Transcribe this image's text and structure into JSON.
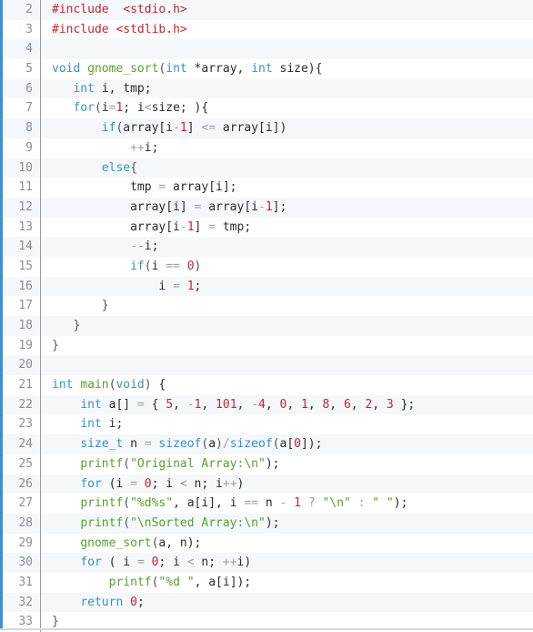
{
  "editor": {
    "language": "c",
    "accent_color": "#3b8fd6",
    "lines": [
      {
        "n": "2",
        "tokens": [
          [
            "pp",
            "#include"
          ],
          [
            "",
            "  "
          ],
          [
            "inc",
            "<stdio.h>"
          ]
        ]
      },
      {
        "n": "3",
        "tokens": [
          [
            "pp",
            "#include"
          ],
          [
            "inc",
            " <stdlib.h>"
          ]
        ]
      },
      {
        "n": "4",
        "tokens": []
      },
      {
        "n": "5",
        "tokens": [
          [
            "kw",
            "void"
          ],
          [
            "",
            " "
          ],
          [
            "fn",
            "gnome_sort"
          ],
          [
            "pun",
            "("
          ],
          [
            "kw",
            "int"
          ],
          [
            "",
            " *array, "
          ],
          [
            "kw",
            "int"
          ],
          [
            "",
            " size){"
          ]
        ]
      },
      {
        "n": "6",
        "tokens": [
          [
            "",
            "   "
          ],
          [
            "kw",
            "int"
          ],
          [
            "",
            " i, tmp;"
          ]
        ]
      },
      {
        "n": "7",
        "tokens": [
          [
            "",
            "   "
          ],
          [
            "kw",
            "for"
          ],
          [
            "pun",
            "("
          ],
          [
            "",
            "i"
          ],
          [
            "op",
            "="
          ],
          [
            "num",
            "1"
          ],
          [
            "",
            "; i"
          ],
          [
            "op",
            "<"
          ],
          [
            "",
            "size; ){"
          ]
        ]
      },
      {
        "n": "8",
        "tokens": [
          [
            "",
            "       "
          ],
          [
            "kw",
            "if"
          ],
          [
            "pun",
            "("
          ],
          [
            "",
            "array[i"
          ],
          [
            "op",
            "-"
          ],
          [
            "num",
            "1"
          ],
          [
            "",
            "] "
          ],
          [
            "op",
            "<="
          ],
          [
            "",
            " array[i])"
          ]
        ]
      },
      {
        "n": "9",
        "tokens": [
          [
            "",
            "           "
          ],
          [
            "op",
            "++"
          ],
          [
            "",
            "i;"
          ]
        ]
      },
      {
        "n": "10",
        "tokens": [
          [
            "",
            "       "
          ],
          [
            "kw",
            "else"
          ],
          [
            "pun",
            "{"
          ]
        ]
      },
      {
        "n": "11",
        "tokens": [
          [
            "",
            "           tmp "
          ],
          [
            "op",
            "="
          ],
          [
            "",
            " array[i];"
          ]
        ]
      },
      {
        "n": "12",
        "tokens": [
          [
            "",
            "           array[i] "
          ],
          [
            "op",
            "="
          ],
          [
            "",
            " array[i"
          ],
          [
            "op",
            "-"
          ],
          [
            "num",
            "1"
          ],
          [
            "",
            "];"
          ]
        ]
      },
      {
        "n": "13",
        "tokens": [
          [
            "",
            "           array[i"
          ],
          [
            "op",
            "-"
          ],
          [
            "num",
            "1"
          ],
          [
            "",
            "] "
          ],
          [
            "op",
            "="
          ],
          [
            "",
            " tmp;"
          ]
        ]
      },
      {
        "n": "14",
        "tokens": [
          [
            "",
            "           "
          ],
          [
            "op",
            "--"
          ],
          [
            "",
            "i;"
          ]
        ]
      },
      {
        "n": "15",
        "tokens": [
          [
            "",
            "           "
          ],
          [
            "kw",
            "if"
          ],
          [
            "pun",
            "("
          ],
          [
            "",
            "i "
          ],
          [
            "op",
            "=="
          ],
          [
            "",
            " "
          ],
          [
            "num",
            "0"
          ],
          [
            "pun",
            ")"
          ]
        ]
      },
      {
        "n": "16",
        "tokens": [
          [
            "",
            "               i "
          ],
          [
            "op",
            "="
          ],
          [
            "",
            " "
          ],
          [
            "num",
            "1"
          ],
          [
            "",
            "; "
          ]
        ]
      },
      {
        "n": "17",
        "tokens": [
          [
            "",
            "       "
          ],
          [
            "pun",
            "}"
          ]
        ]
      },
      {
        "n": "18",
        "tokens": [
          [
            "",
            "   "
          ],
          [
            "pun",
            "}"
          ]
        ]
      },
      {
        "n": "19",
        "tokens": [
          [
            "pun",
            "}"
          ]
        ]
      },
      {
        "n": "20",
        "tokens": []
      },
      {
        "n": "21",
        "tokens": [
          [
            "kw",
            "int"
          ],
          [
            "",
            " "
          ],
          [
            "fn",
            "main"
          ],
          [
            "pun",
            "("
          ],
          [
            "kw",
            "void"
          ],
          [
            "pun",
            ")"
          ],
          [
            "",
            " {"
          ]
        ]
      },
      {
        "n": "22",
        "tokens": [
          [
            "",
            "    "
          ],
          [
            "kw",
            "int"
          ],
          [
            "",
            " a[] "
          ],
          [
            "op",
            "="
          ],
          [
            "",
            " { "
          ],
          [
            "num",
            "5"
          ],
          [
            ", "
          ],
          [
            "op",
            "-"
          ],
          [
            "num",
            "1"
          ],
          [
            ", "
          ],
          [
            "num",
            "101"
          ],
          [
            ", "
          ],
          [
            "op",
            "-"
          ],
          [
            "num",
            "4"
          ],
          [
            ", "
          ],
          [
            "num",
            "0"
          ],
          [
            ", "
          ],
          [
            "num",
            "1"
          ],
          [
            ", "
          ],
          [
            "num",
            "8"
          ],
          [
            ", "
          ],
          [
            "num",
            "6"
          ],
          [
            ", "
          ],
          [
            "num",
            "2"
          ],
          [
            ", "
          ],
          [
            "num",
            "3"
          ],
          [
            "",
            " };"
          ]
        ]
      },
      {
        "n": "23",
        "tokens": [
          [
            "",
            "    "
          ],
          [
            "kw",
            "int"
          ],
          [
            "",
            " i;"
          ]
        ]
      },
      {
        "n": "24",
        "tokens": [
          [
            "",
            "    "
          ],
          [
            "kw",
            "size_t"
          ],
          [
            "",
            " n "
          ],
          [
            "op",
            "="
          ],
          [
            "",
            " "
          ],
          [
            "kw",
            "sizeof"
          ],
          [
            "pun",
            "("
          ],
          [
            "",
            "a"
          ],
          [
            "pun",
            ")"
          ],
          [
            "op",
            "/"
          ],
          [
            "kw",
            "sizeof"
          ],
          [
            "pun",
            "("
          ],
          [
            "",
            "a["
          ],
          [
            "num",
            "0"
          ],
          [
            "",
            "]);"
          ]
        ]
      },
      {
        "n": "25",
        "tokens": [
          [
            "",
            "    "
          ],
          [
            "fn",
            "printf"
          ],
          [
            "pun",
            "("
          ],
          [
            "str",
            "\"Original Array:\\n\""
          ],
          [
            "",
            ");"
          ]
        ]
      },
      {
        "n": "26",
        "tokens": [
          [
            "",
            "    "
          ],
          [
            "kw",
            "for"
          ],
          [
            "",
            " (i "
          ],
          [
            "op",
            "="
          ],
          [
            "",
            " "
          ],
          [
            "num",
            "0"
          ],
          [
            "",
            "; i "
          ],
          [
            "op",
            "<"
          ],
          [
            "",
            " n; i"
          ],
          [
            "op",
            "++"
          ],
          [
            "",
            ")"
          ]
        ]
      },
      {
        "n": "27",
        "tokens": [
          [
            "",
            "    "
          ],
          [
            "fn",
            "printf"
          ],
          [
            "pun",
            "("
          ],
          [
            "str",
            "\"%d%s\""
          ],
          [
            "",
            ", a[i], i "
          ],
          [
            "op",
            "=="
          ],
          [
            "",
            " n "
          ],
          [
            "op",
            "-"
          ],
          [
            "",
            " "
          ],
          [
            "num",
            "1"
          ],
          [
            "",
            " "
          ],
          [
            "op",
            "?"
          ],
          [
            "",
            " "
          ],
          [
            "str",
            "\"\\n\""
          ],
          [
            "",
            " "
          ],
          [
            "op",
            ":"
          ],
          [
            "",
            " "
          ],
          [
            "str",
            "\" \""
          ],
          [
            "",
            ");"
          ]
        ]
      },
      {
        "n": "28",
        "tokens": [
          [
            "",
            "    "
          ],
          [
            "fn",
            "printf"
          ],
          [
            "pun",
            "("
          ],
          [
            "str",
            "\"\\nSorted Array:\\n\""
          ],
          [
            "",
            ");"
          ]
        ]
      },
      {
        "n": "29",
        "tokens": [
          [
            "",
            "    "
          ],
          [
            "fn",
            "gnome_sort"
          ],
          [
            "pun",
            "("
          ],
          [
            "",
            "a, n);"
          ]
        ]
      },
      {
        "n": "30",
        "tokens": [
          [
            "",
            "    "
          ],
          [
            "kw",
            "for"
          ],
          [
            "",
            " ( i "
          ],
          [
            "op",
            "="
          ],
          [
            "",
            " "
          ],
          [
            "num",
            "0"
          ],
          [
            "",
            "; i "
          ],
          [
            "op",
            "<"
          ],
          [
            "",
            " n; "
          ],
          [
            "op",
            "++"
          ],
          [
            "",
            "i)"
          ]
        ]
      },
      {
        "n": "31",
        "tokens": [
          [
            "",
            "        "
          ],
          [
            "fn",
            "printf"
          ],
          [
            "pun",
            "("
          ],
          [
            "str",
            "\"%d \""
          ],
          [
            "",
            ", a[i]);"
          ]
        ]
      },
      {
        "n": "32",
        "tokens": [
          [
            "",
            "    "
          ],
          [
            "kw",
            "return"
          ],
          [
            "",
            " "
          ],
          [
            "num",
            "0"
          ],
          [
            "",
            ";"
          ]
        ]
      },
      {
        "n": "33",
        "tokens": [
          [
            "pun",
            "}"
          ]
        ]
      }
    ]
  }
}
